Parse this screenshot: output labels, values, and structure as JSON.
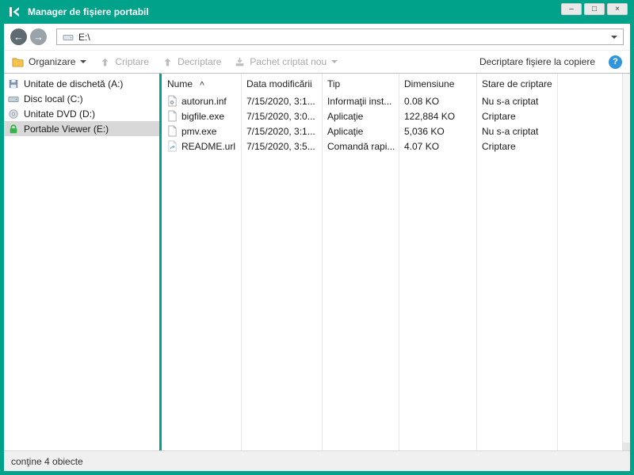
{
  "colors": {
    "accent_green": "#00a289",
    "selection_gray": "#d8d8d8",
    "help_blue": "#2f96dd",
    "disabled_text": "#a9a9a9"
  },
  "icons": {
    "back": "←",
    "forward": "→",
    "help": "?",
    "sort_asc": "^"
  },
  "window_controls": {
    "minimize": "–",
    "maximize": "□",
    "close": "×"
  },
  "titlebar": {
    "title": "Manager de fişiere portabil"
  },
  "nav": {
    "address": "E:\\"
  },
  "toolbar": {
    "organize": "Organizare",
    "encrypt": "Criptare",
    "decrypt": "Decriptare",
    "new_package": "Pachet criptat nou",
    "decrypt_on_copy": "Decriptare fişiere la copiere"
  },
  "sidebar": {
    "items": [
      {
        "label": "Unitate de dischetă (A:)",
        "icon": "floppy-disk-icon",
        "selected": false
      },
      {
        "label": "Disc local (C:)",
        "icon": "hard-drive-icon",
        "selected": false
      },
      {
        "label": "Unitate DVD (D:)",
        "icon": "dvd-drive-icon",
        "selected": false
      },
      {
        "label": "Portable Viewer (E:)",
        "icon": "encrypted-drive-lock-icon",
        "selected": true
      }
    ]
  },
  "filelist": {
    "columns": [
      "Nume",
      "Data modificării",
      "Tip",
      "Dimensiune",
      "Stare de criptare"
    ],
    "sort_column": "Nume",
    "sort_direction": "asc",
    "rows": [
      {
        "name": "autorun.inf",
        "icon": "setup-information-file-icon",
        "date": "7/15/2020, 3:1...",
        "type": "Informaţii inst...",
        "size": "0.08 KO",
        "status": "Nu s-a criptat"
      },
      {
        "name": "bigfile.exe",
        "icon": "application-file-icon",
        "date": "7/15/2020, 3:0...",
        "type": "Aplicaţie",
        "size": "122,884 KO",
        "status": "Criptare"
      },
      {
        "name": "pmv.exe",
        "icon": "application-file-icon",
        "date": "7/15/2020, 3:1...",
        "type": "Aplicaţie",
        "size": "5,036 KO",
        "status": "Nu s-a criptat"
      },
      {
        "name": "README.url",
        "icon": "shortcut-file-icon",
        "date": "7/15/2020, 3:5...",
        "type": "Comandă rapi...",
        "size": "4.07 KO",
        "status": "Criptare"
      }
    ]
  },
  "statusbar": {
    "text": "conţine 4 obiecte"
  }
}
